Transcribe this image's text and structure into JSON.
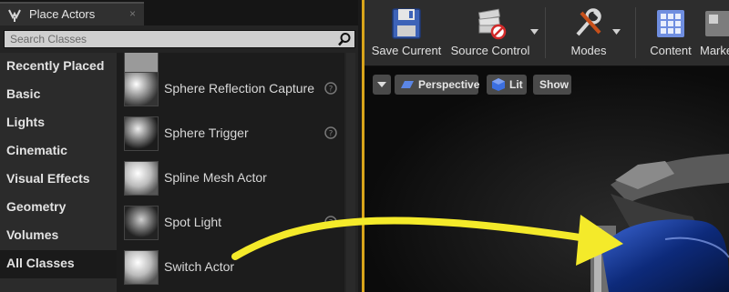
{
  "tab": {
    "title": "Place Actors",
    "close": "×"
  },
  "search": {
    "placeholder": "Search Classes"
  },
  "categories": [
    {
      "label": "Recently Placed"
    },
    {
      "label": "Basic"
    },
    {
      "label": "Lights"
    },
    {
      "label": "Cinematic"
    },
    {
      "label": "Visual Effects"
    },
    {
      "label": "Geometry"
    },
    {
      "label": "Volumes"
    },
    {
      "label": "All Classes",
      "selected": true
    }
  ],
  "items": [
    {
      "label": "Sphere Reflection Capture",
      "icon": "sphere-reflection-capture-icon"
    },
    {
      "label": "Sphere Trigger",
      "icon": "sphere-trigger-icon"
    },
    {
      "label": "Spline Mesh Actor",
      "icon": "spline-mesh-actor-icon"
    },
    {
      "label": "Spot Light",
      "icon": "spot-light-icon"
    },
    {
      "label": "Switch Actor",
      "icon": "switch-actor-icon"
    }
  ],
  "toolbar": {
    "save": "Save Current",
    "source_control": "Source Control",
    "modes": "Modes",
    "content": "Content",
    "marketplace": "Marke"
  },
  "viewport": {
    "perspective": "Perspective",
    "lit": "Lit",
    "show": "Show"
  },
  "colors": {
    "accent": "#d9a51a",
    "arrow": "#f4ea2a"
  }
}
